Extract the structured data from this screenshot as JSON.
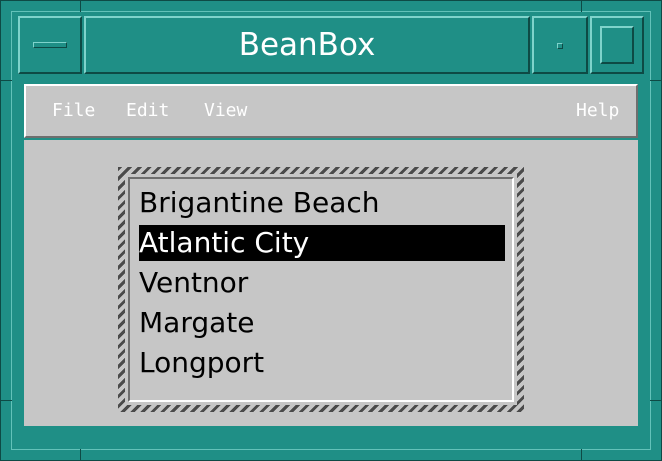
{
  "window": {
    "title": "BeanBox"
  },
  "menubar": {
    "items": [
      {
        "label": "File"
      },
      {
        "label": "Edit"
      },
      {
        "label": "View"
      }
    ],
    "help": {
      "label": "Help"
    }
  },
  "list": {
    "items": [
      "Brigantine Beach",
      "Atlantic City",
      "Ventnor",
      "Margate",
      "Longport"
    ],
    "selected_index": 1
  },
  "colors": {
    "frame": "#1f8f86",
    "panel": "#c6c6c6",
    "selection_bg": "#000000",
    "selection_fg": "#ffffff"
  },
  "icons": [
    "window-menu-icon",
    "minimize-icon",
    "maximize-icon"
  ]
}
